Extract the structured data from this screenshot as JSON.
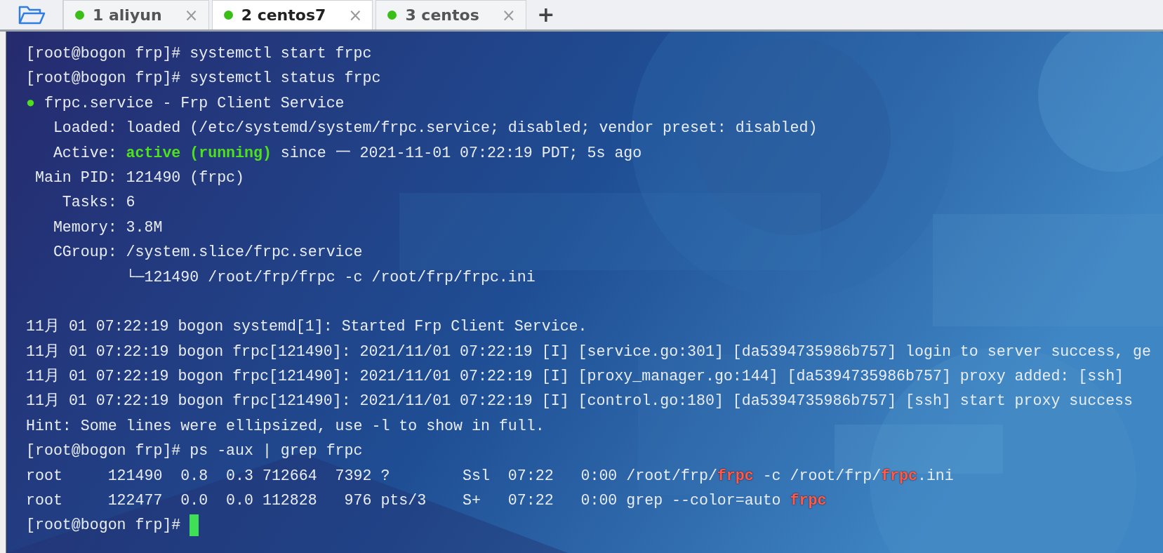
{
  "tabs": [
    {
      "label": "1 aliyun",
      "selected": false,
      "close": "×"
    },
    {
      "label": "2 centos7",
      "selected": true,
      "close": "×"
    },
    {
      "label": "3 centos",
      "selected": false,
      "close": "×"
    }
  ],
  "new_tab": "+",
  "terminal": {
    "background": {
      "kind": "picture"
    },
    "lines": [
      [
        {
          "kind": "plain",
          "text": "[root@bogon frp]# systemctl start frpc"
        }
      ],
      [
        {
          "kind": "plain",
          "text": "[root@bogon frp]# systemctl status frpc"
        }
      ],
      [
        {
          "kind": "status",
          "text": "●"
        },
        {
          "kind": "plain",
          "text": " frpc.service - Frp Client Service"
        }
      ],
      [
        {
          "kind": "plain",
          "text": "   Loaded: loaded (/etc/systemd/system/frpc.service; disabled; vendor preset: disabled)"
        }
      ],
      [
        {
          "kind": "plain",
          "text": "   Active: "
        },
        {
          "kind": "ok",
          "text": "active (running)"
        },
        {
          "kind": "plain",
          "text": " since 一 2021-11-01 07:22:19 PDT; 5s ago"
        }
      ],
      [
        {
          "kind": "plain",
          "text": " Main PID: 121490 (frpc)"
        }
      ],
      [
        {
          "kind": "plain",
          "text": "    Tasks: 6"
        }
      ],
      [
        {
          "kind": "plain",
          "text": "   Memory: 3.8M"
        }
      ],
      [
        {
          "kind": "plain",
          "text": "   CGroup: /system.slice/frpc.service"
        }
      ],
      [
        {
          "kind": "plain",
          "text": "           └─121490 /root/frp/frpc -c /root/frp/frpc.ini"
        }
      ],
      {
        "kind": "blank"
      },
      [
        {
          "kind": "plain",
          "text": "11月 01 07:22:19 bogon systemd[1]: Started Frp Client Service."
        }
      ],
      [
        {
          "kind": "plain",
          "text": "11月 01 07:22:19 bogon frpc[121490]: 2021/11/01 07:22:19 [I] [service.go:301] [da5394735986b757] login to server success, ge"
        }
      ],
      [
        {
          "kind": "plain",
          "text": "11月 01 07:22:19 bogon frpc[121490]: 2021/11/01 07:22:19 [I] [proxy_manager.go:144] [da5394735986b757] proxy added: [ssh]"
        }
      ],
      [
        {
          "kind": "plain",
          "text": "11月 01 07:22:19 bogon frpc[121490]: 2021/11/01 07:22:19 [I] [control.go:180] [da5394735986b757] [ssh] start proxy success"
        }
      ],
      [
        {
          "kind": "plain",
          "text": "Hint: Some lines were ellipsized, use -l to show in full."
        }
      ],
      [
        {
          "kind": "plain",
          "text": "[root@bogon frp]# ps -aux | grep frpc"
        }
      ],
      [
        {
          "kind": "plain",
          "text": "root     121490  0.8  0.3 712664  7392 ?        Ssl  07:22   0:00 /root/frp/"
        },
        {
          "kind": "match",
          "text": "frpc"
        },
        {
          "kind": "plain",
          "text": " -c /root/frp/"
        },
        {
          "kind": "match",
          "text": "frpc"
        },
        {
          "kind": "plain",
          "text": ".ini"
        }
      ],
      [
        {
          "kind": "plain",
          "text": "root     122477  0.0  0.0 112828   976 pts/3    S+   07:22   0:00 grep --color=auto "
        },
        {
          "kind": "match",
          "text": "frpc"
        }
      ],
      [
        {
          "kind": "plain",
          "text": "[root@bogon frp]# "
        },
        {
          "kind": "cursor"
        }
      ]
    ]
  }
}
